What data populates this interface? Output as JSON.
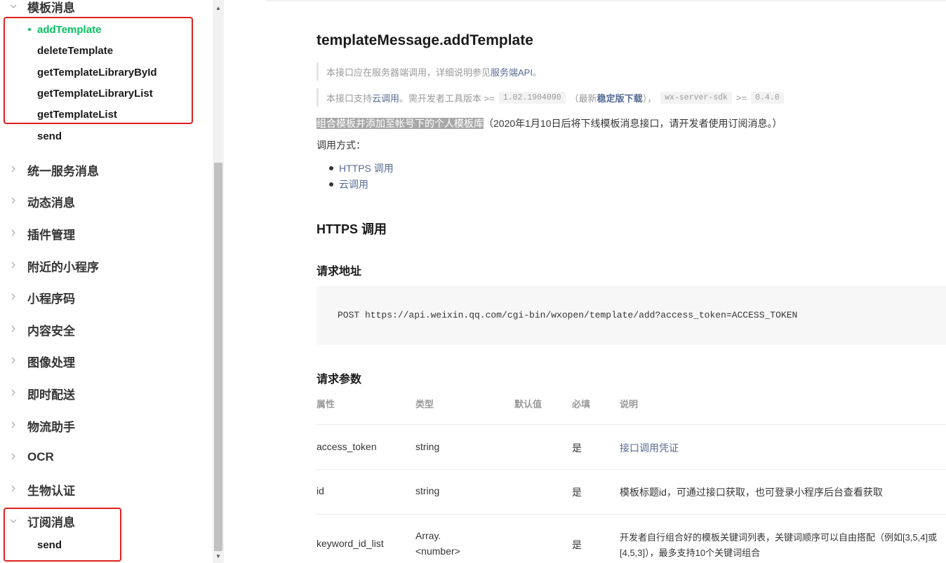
{
  "sidebar": {
    "top_group": {
      "label": "模板消息",
      "chevron": "chevron-down-icon"
    },
    "top_items": [
      {
        "label": "addTemplate",
        "active": true
      },
      {
        "label": "deleteTemplate"
      },
      {
        "label": "getTemplateLibraryById"
      },
      {
        "label": "getTemplateLibraryList"
      },
      {
        "label": "getTemplateList"
      },
      {
        "label": "send"
      }
    ],
    "groups": [
      {
        "label": "统一服务消息"
      },
      {
        "label": "动态消息"
      },
      {
        "label": "插件管理"
      },
      {
        "label": "附近的小程序"
      },
      {
        "label": "小程序码"
      },
      {
        "label": "内容安全"
      },
      {
        "label": "图像处理"
      },
      {
        "label": "即时配送"
      },
      {
        "label": "物流助手"
      },
      {
        "label": "OCR"
      },
      {
        "label": "生物认证"
      }
    ],
    "bottom_group": {
      "label": "订阅消息",
      "chevron": "chevron-down-icon"
    },
    "bottom_items": [
      {
        "label": "send"
      }
    ]
  },
  "colors": {
    "active": "#07c160",
    "link": "#576b95",
    "annotation_box": "#e02020"
  },
  "main": {
    "title": "templateMessage.addTemplate",
    "note1": {
      "prefix": "本接口应在服务器端调用，详细说明参见",
      "link": "服务端API",
      "suffix": "。"
    },
    "note2": {
      "prefix": "本接口支持",
      "link": "云调用",
      "mid": "。需开发者工具版本 >=",
      "version": "1.02.1904090",
      "paren_open": "（最新",
      "stable_link": "稳定版下载",
      "paren_close": "），",
      "sdk": "wx-server-sdk",
      "gte": ">=",
      "sdk_version": "0.4.0"
    },
    "desc": {
      "highlight": "组合模板并添加至帐号下的个人模板库",
      "rest": "（2020年1月10日后将下线模板消息接口，请开发者使用订阅消息。）"
    },
    "call_label": "调用方式：",
    "methods": [
      "HTTPS 调用",
      "云调用"
    ],
    "https_heading": "HTTPS 调用",
    "request_url_heading": "请求地址",
    "request_url": "POST https://api.weixin.qq.com/cgi-bin/wxopen/template/add?access_token=ACCESS_TOKEN",
    "params_heading": "请求参数",
    "table": {
      "headers": [
        "属性",
        "类型",
        "默认值",
        "必填",
        "说明"
      ],
      "rows": [
        {
          "name": "access_token",
          "type": "string",
          "default": "",
          "required": "是",
          "desc": "接口调用凭证",
          "desc_is_link": true
        },
        {
          "name": "id",
          "type": "string",
          "default": "",
          "required": "是",
          "desc": "模板标题id，可通过接口获取，也可登录小程序后台查看获取"
        },
        {
          "name": "keyword_id_list",
          "type_line1": "Array.",
          "type_line2": "<number>",
          "default": "",
          "required": "是",
          "desc_line1": "开发者自行组合好的模板关键词列表，关键词顺序可以自由搭配（例如[3,5,4]或",
          "desc_line2": "[4,5,3]），最多支持10个关键词组合"
        }
      ]
    }
  }
}
